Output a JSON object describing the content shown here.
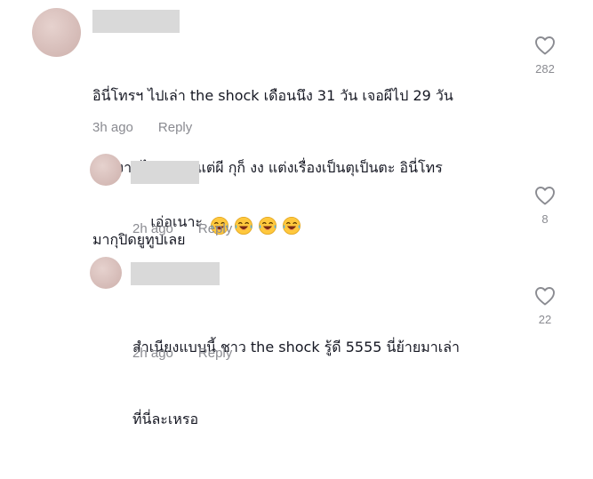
{
  "comments": [
    {
      "text_lines": [
        "อินี่โทรฯ ไปเล่า the shock เดือนนึง 31 วัน เจอผีไป 29 วัน",
        "การงานไม่ทำเจอแต่ผี กุก็ งง แต่งเรื่องเป็นตุเป็นตะ อินี่โทร",
        "มากุปิดยูทูปเลย"
      ],
      "time": "3h ago",
      "reply_label": "Reply",
      "likes": "282"
    },
    {
      "text_lines": [
        "เอ่อเนาะ"
      ],
      "emoji_name": "face-with-tears-of-joy-icon",
      "emoji_count": 4,
      "time": "2h ago",
      "reply_label": "Reply",
      "likes": "8"
    },
    {
      "text_lines": [
        "สำเนียงแบบนี้ ชาว the shock รู้ดี 5555 นี่ย้ายมาเล่า",
        "ที่นี่ละเหรอ"
      ],
      "time": "2h ago",
      "reply_label": "Reply",
      "likes": "22"
    }
  ],
  "colors": {
    "text": "#161823",
    "meta": "#8a8b91",
    "username_placeholder": "#d9d9d9"
  }
}
